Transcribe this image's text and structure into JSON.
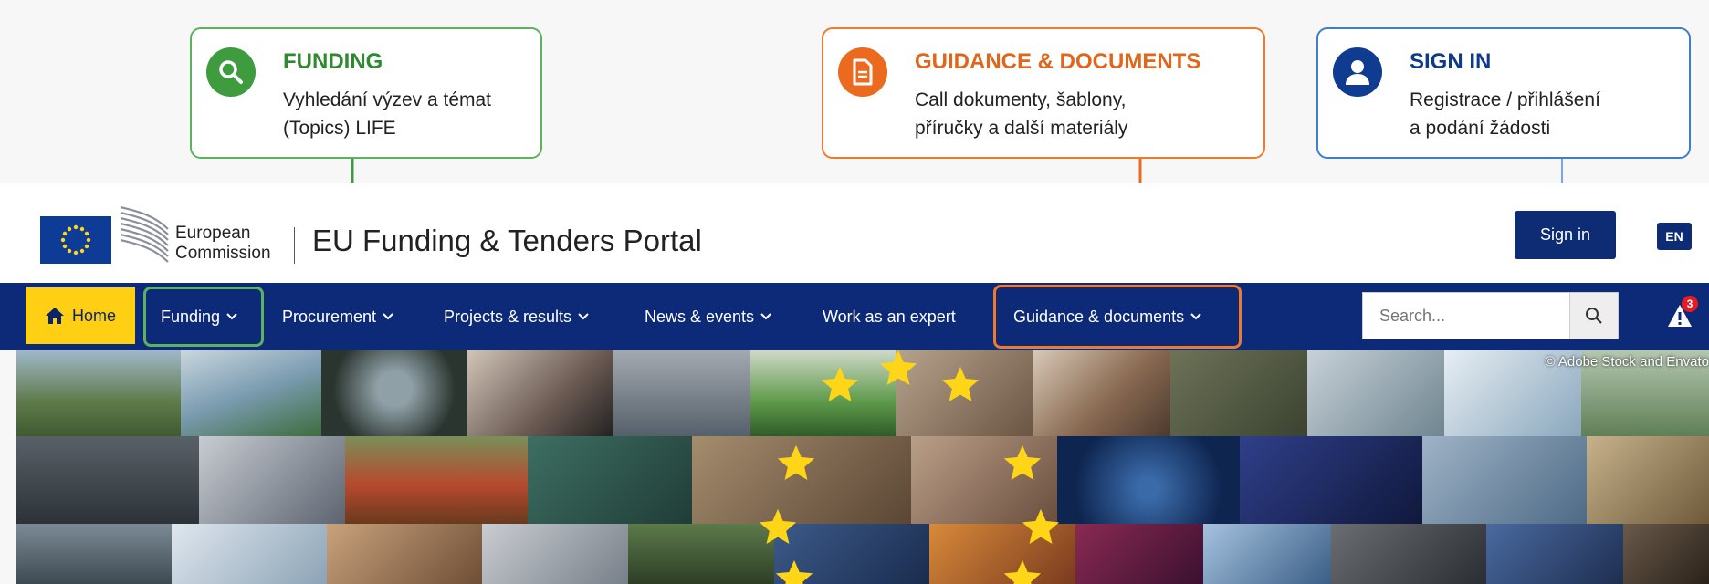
{
  "callouts": {
    "funding": {
      "title": "FUNDING",
      "desc": "Vyhledání výzev a témat\n(Topics) LIFE",
      "icon": "search-icon",
      "color": "#3e9b3e"
    },
    "guidance": {
      "title": "GUIDANCE & DOCUMENTS",
      "desc": "Call dokumenty, šablony,\npříručky a další materiály",
      "icon": "document-icon",
      "color": "#ec6a1f"
    },
    "signin": {
      "title": "SIGN IN",
      "desc": "Registrace / přihlášení\na podání žádosti",
      "icon": "user-icon",
      "color": "#0f3c91"
    }
  },
  "header": {
    "org_line1": "European",
    "org_line2": "Commission",
    "portal_title": "EU Funding & Tenders Portal",
    "signin_label": "Sign in",
    "language": "EN"
  },
  "nav": {
    "home": "Home",
    "items": [
      "Funding",
      "Procurement",
      "Projects & results",
      "News & events",
      "Work as an expert",
      "Guidance & documents"
    ],
    "search_placeholder": "Search...",
    "notification_count": "3"
  },
  "banner": {
    "credit": "© Adobe Stock and Envato"
  },
  "colors": {
    "nav_bg": "#0c2a77",
    "home_bg": "#ffcf14",
    "funding_highlight": "#5db35d",
    "guidance_highlight": "#f07a2a",
    "signin_highlight": "#3c7fd0"
  }
}
